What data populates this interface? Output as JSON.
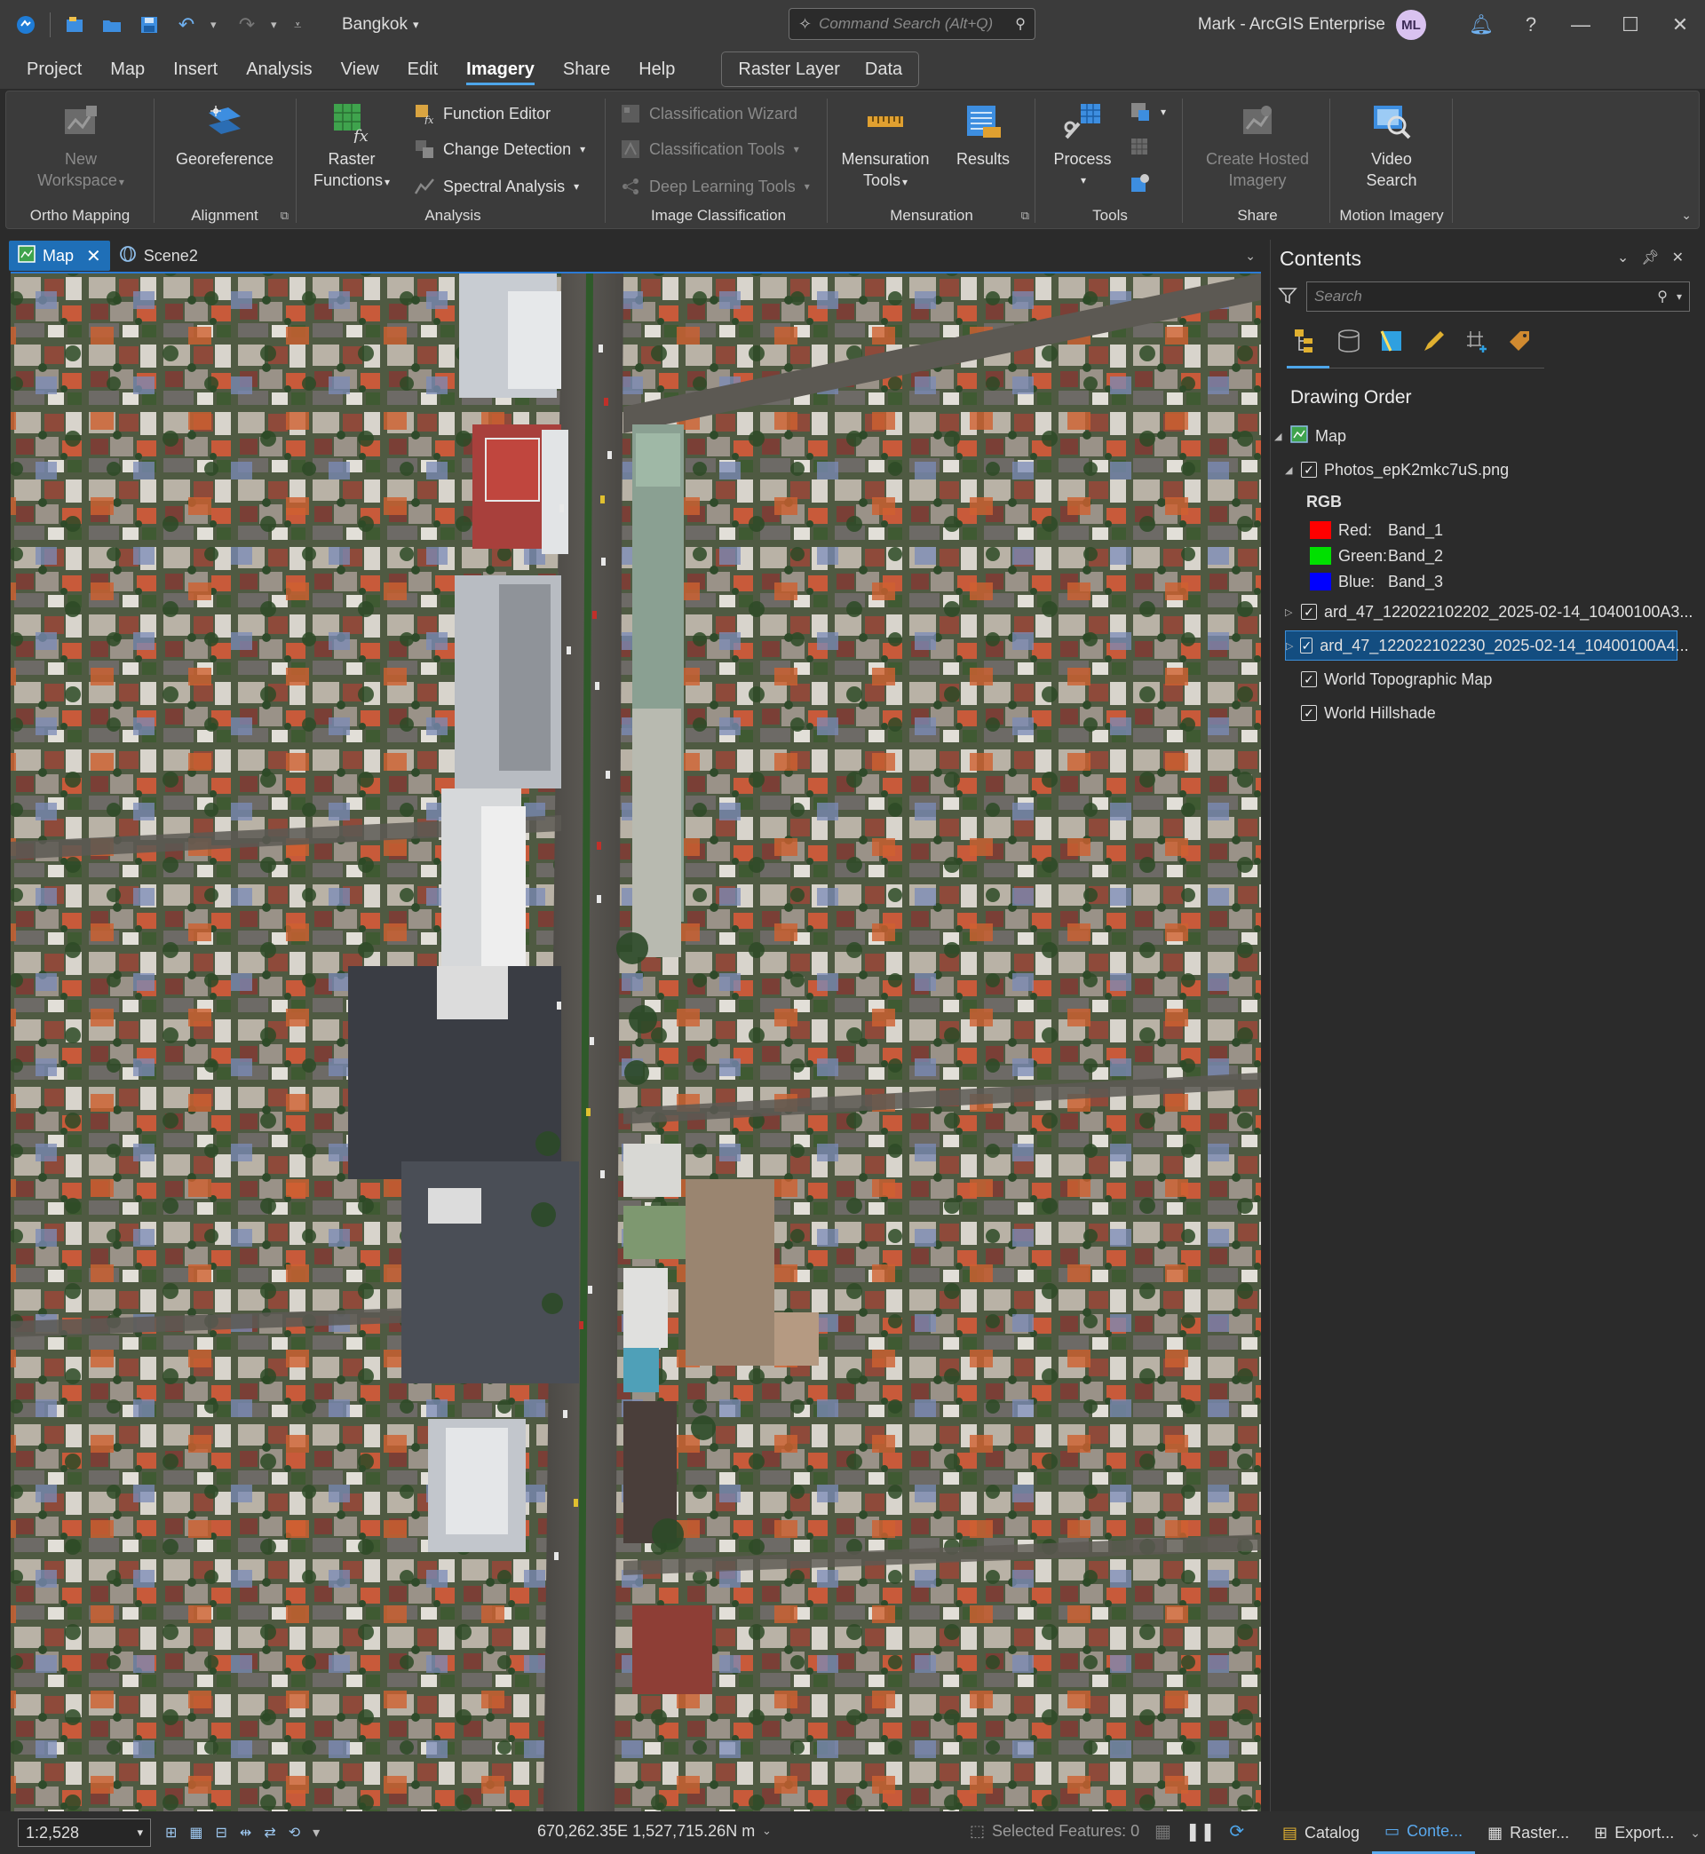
{
  "titlebar": {
    "project_name": "Bangkok",
    "command_search_placeholder": "Command Search (Alt+Q)",
    "user": "Mark - ArcGIS Enterprise",
    "avatar_initials": "ML"
  },
  "menu": {
    "tabs": [
      "Project",
      "Map",
      "Insert",
      "Analysis",
      "View",
      "Edit",
      "Imagery",
      "Share",
      "Help"
    ],
    "active": "Imagery",
    "contextual_tabs": [
      "Raster Layer",
      "Data"
    ]
  },
  "ribbon": {
    "ortho": {
      "label": "Ortho Mapping",
      "new_workspace": [
        "New",
        "Workspace"
      ]
    },
    "alignment": {
      "label": "Alignment",
      "georeference": "Georeference"
    },
    "analysis": {
      "label": "Analysis",
      "raster_functions": [
        "Raster",
        "Functions"
      ],
      "function_editor": "Function Editor",
      "change_detection": "Change Detection",
      "spectral_analysis": "Spectral Analysis"
    },
    "classification": {
      "label": "Image Classification",
      "wizard": "Classification Wizard",
      "tools": "Classification Tools",
      "deep_learning": "Deep Learning Tools"
    },
    "mensuration": {
      "label": "Mensuration",
      "tools": [
        "Mensuration",
        "Tools"
      ],
      "results": "Results"
    },
    "tools": {
      "label": "Tools",
      "process": "Process"
    },
    "share": {
      "label": "Share",
      "create_hosted": [
        "Create Hosted",
        "Imagery"
      ]
    },
    "motion": {
      "label": "Motion Imagery",
      "video_search": [
        "Video",
        "Search"
      ]
    }
  },
  "views": {
    "tabs": [
      {
        "label": "Map",
        "active": true
      },
      {
        "label": "Scene2",
        "active": false
      }
    ]
  },
  "contents": {
    "title": "Contents",
    "search_placeholder": "Search",
    "section": "Drawing Order",
    "map_name": "Map",
    "layer1": "Photos_epK2mkc7uS.png",
    "rgb_label": "RGB",
    "bands": [
      {
        "channel": "Red:",
        "band": "Band_1",
        "color": "#ff0000"
      },
      {
        "channel": "Green:",
        "band": "Band_2",
        "color": "#00e000"
      },
      {
        "channel": "Blue:",
        "band": "Band_3",
        "color": "#0000ff"
      }
    ],
    "layer2": "ard_47_122022102202_2025-02-14_10400100A3...",
    "layer3": "ard_47_122022102230_2025-02-14_10400100A4...",
    "layer4": "World Topographic Map",
    "layer5": "World Hillshade"
  },
  "status": {
    "scale": "1:2,528",
    "coordinates": "670,262.35E 1,527,715.26N m",
    "selected_features": "Selected Features: 0"
  },
  "dock_tabs": [
    "Catalog",
    "Conte...",
    "Raster...",
    "Export..."
  ]
}
